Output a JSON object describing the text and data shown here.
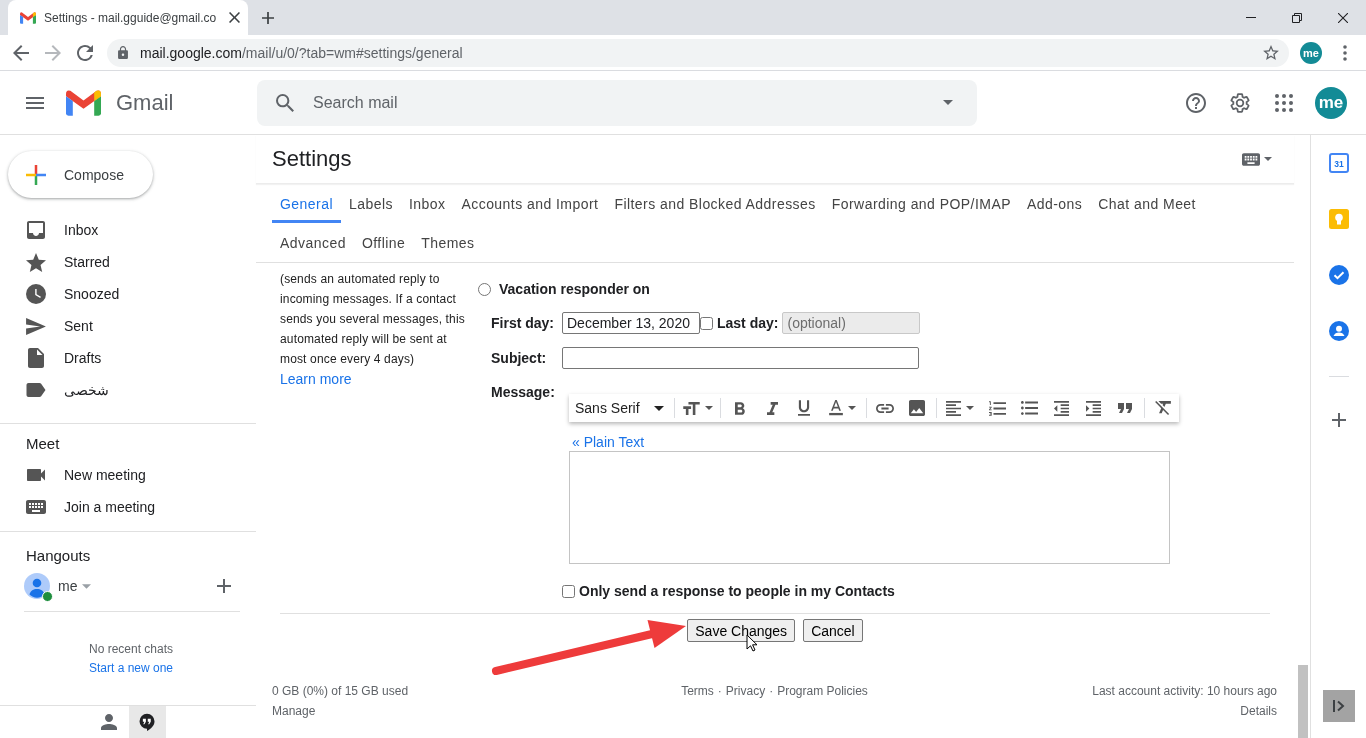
{
  "browser": {
    "tabs": [
      {
        "title": "Settings - mail.gguide@gmail.co",
        "selected": true
      }
    ],
    "url": {
      "host": "mail.google.com",
      "path": "/mail/u/0/?tab=wm#settings/general"
    },
    "profile": "me"
  },
  "header": {
    "product": "Gmail",
    "search": {
      "placeholder": "Search mail"
    },
    "avatar": "me"
  },
  "sidebar": {
    "compose": "Compose",
    "items": [
      {
        "label": "Inbox",
        "selected": false
      },
      {
        "label": "Starred",
        "selected": false
      },
      {
        "label": "Snoozed",
        "selected": false
      },
      {
        "label": "Sent",
        "selected": false
      },
      {
        "label": "Drafts",
        "selected": false
      },
      {
        "label": "شخصی",
        "selected": false
      }
    ],
    "meet": {
      "title": "Meet",
      "items": [
        "New meeting",
        "Join a meeting"
      ]
    },
    "hangouts": {
      "title": "Hangouts",
      "user": "me",
      "online": true,
      "empty_text": "No recent chats",
      "start_link": "Start a new one"
    },
    "bottom_tabs": [
      {
        "selected": false
      },
      {
        "selected": true
      }
    ]
  },
  "settings": {
    "title": "Settings",
    "tabs": [
      {
        "label": "General",
        "selected": true
      },
      {
        "label": "Labels",
        "selected": false
      },
      {
        "label": "Inbox",
        "selected": false
      },
      {
        "label": "Accounts and Import",
        "selected": false
      },
      {
        "label": "Filters and Blocked Addresses",
        "selected": false
      },
      {
        "label": "Forwarding and POP/IMAP",
        "selected": false
      },
      {
        "label": "Add-ons",
        "selected": false
      },
      {
        "label": "Chat and Meet",
        "selected": false
      },
      {
        "label": "Advanced",
        "selected": false
      },
      {
        "label": "Offline",
        "selected": false
      },
      {
        "label": "Themes",
        "selected": false
      }
    ],
    "vacation": {
      "description": "(sends an automated reply to incoming messages. If a contact sends you several messages, this automated reply will be sent at most once every 4 days)",
      "learn_more": "Learn more",
      "responder_on": {
        "label": "Vacation responder on",
        "selected": false
      },
      "first_day": {
        "label": "First day:",
        "value": "December 13, 2020"
      },
      "last_day": {
        "label": "Last day:",
        "checked": false,
        "placeholder": "(optional)",
        "disabled": true
      },
      "subject": {
        "label": "Subject:"
      },
      "message": {
        "label": "Message:",
        "font": "Sans Serif",
        "plain_text_link": "« Plain Text"
      },
      "contacts_only": {
        "label": "Only send a response to people in my Contacts",
        "checked": false
      }
    },
    "buttons": [
      "Save Changes",
      "Cancel"
    ]
  },
  "footer": {
    "storage": "0 GB (0%) of 15 GB used",
    "manage": "Manage",
    "links": [
      "Terms",
      "Privacy",
      "Program Policies"
    ],
    "separator": "·",
    "activity": "Last account activity: 10 hours ago",
    "details": "Details"
  },
  "side_panel": {
    "calendar_day": "31"
  }
}
